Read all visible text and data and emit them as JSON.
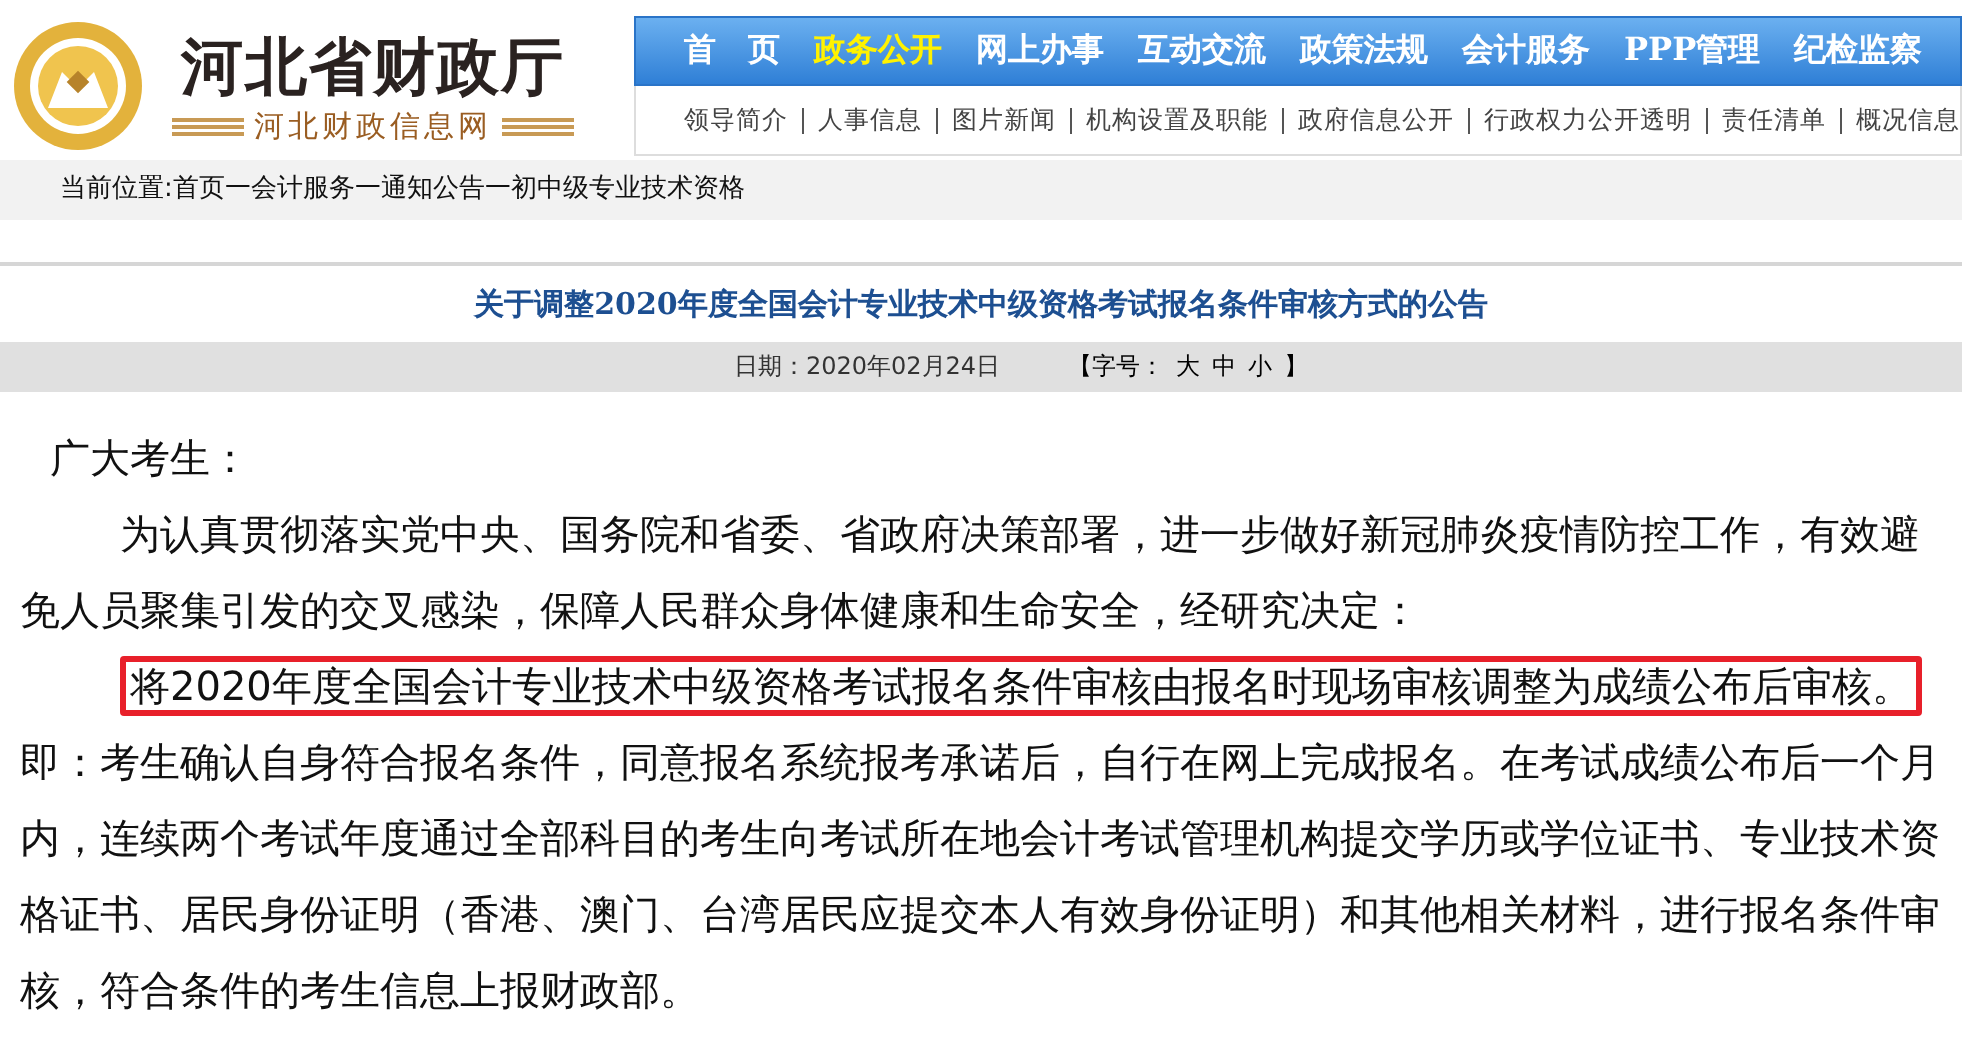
{
  "header": {
    "title": "河北省财政厅",
    "subtitle": "河北财政信息网"
  },
  "nav": {
    "items": [
      {
        "label": "首　页",
        "selected": false
      },
      {
        "label": "政务公开",
        "selected": true
      },
      {
        "label": "网上办事",
        "selected": false
      },
      {
        "label": "互动交流",
        "selected": false
      },
      {
        "label": "政策法规",
        "selected": false
      },
      {
        "label": "会计服务",
        "selected": false
      },
      {
        "label": "PPP管理",
        "selected": false
      },
      {
        "label": "纪检监察",
        "selected": false
      }
    ],
    "subitems": [
      "领导简介",
      "人事信息",
      "图片新闻",
      "机构设置及职能",
      "政府信息公开",
      "行政权力公开透明",
      "责任清单",
      "概况信息"
    ]
  },
  "breadcrumb": "当前位置:首页一会计服务一通知公告一初中级专业技术资格",
  "article": {
    "title": "关于调整2020年度全国会计专业技术中级资格考试报名条件审核方式的公告",
    "date": "日期：2020年02月24日",
    "font_size": {
      "label": "【字号：",
      "options": [
        "大",
        "中",
        "小"
      ],
      "close": "】"
    },
    "greeting": "广大考生：",
    "paragraphs": [
      {
        "text": "为认真贯彻落实党中央、国务院和省委、省政府决策部署，进一步做好新冠肺炎疫情防控工作，有效避免人员聚集引发的交叉感染，保障人民群众身体健康和生命安全，经研究决定："
      },
      {
        "highlight": "将2020年度全国会计专业技术中级资格考试报名条件审核由报名时现场审核调整为成绩公布后审核。",
        "text": "即：考生确认自身符合报名条件，同意报名系统报考承诺后，自行在网上完成报名。在考试成绩公布后一个月内，连续两个考试年度通过全部科目的考生向考试所在地会计考试管理机构提交学历或学位证书、专业技术资格证书、居民身份证明（香港、澳门、台湾居民应提交本人有效身份证明）和其他相关材料，进行报名条件审核，符合条件的考生信息上报财政部。"
      }
    ]
  }
}
